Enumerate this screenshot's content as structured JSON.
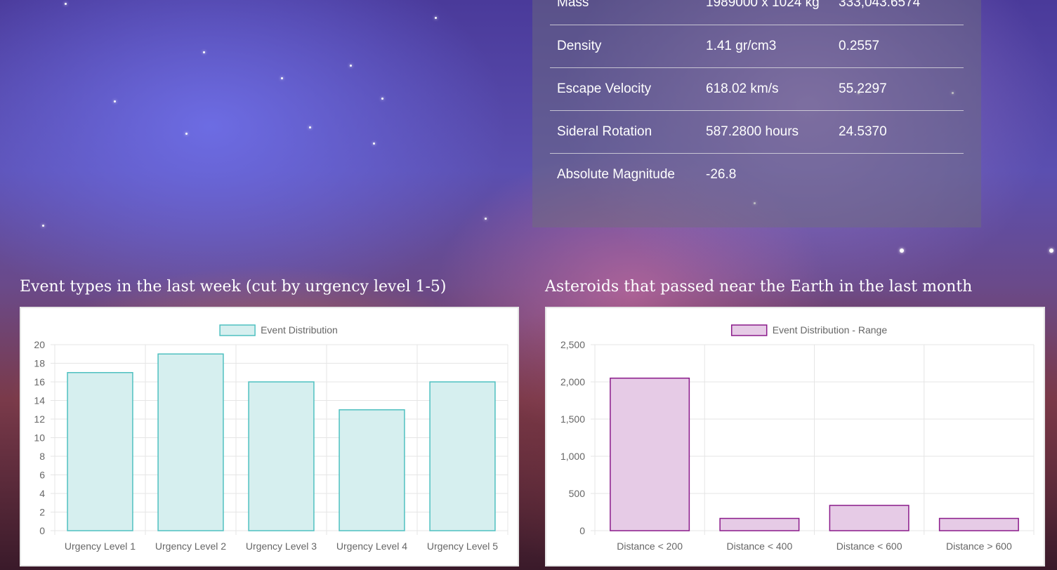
{
  "info_table": {
    "rows": [
      {
        "property": "Mass",
        "value": "1989000 x 1024 kg",
        "relative": "333,043.6574"
      },
      {
        "property": "Density",
        "value": "1.41 gr/cm3",
        "relative": "0.2557"
      },
      {
        "property": "Escape Velocity",
        "value": "618.02 km/s",
        "relative": "55.2297"
      },
      {
        "property": "Sideral Rotation",
        "value": "587.2800 hours",
        "relative": "24.5370"
      },
      {
        "property": "Absolute Magnitude",
        "value": "-26.8",
        "relative": ""
      }
    ]
  },
  "charts": {
    "events_title": "Event types in the last week (cut by urgency level 1-5)",
    "asteroids_title": "Asteroids that passed near the Earth in the last month"
  },
  "chart_data": [
    {
      "type": "bar",
      "title": "Event types in the last week (cut by urgency level 1-5)",
      "categories": [
        "Urgency Level 1",
        "Urgency Level 2",
        "Urgency Level 3",
        "Urgency Level 4",
        "Urgency Level 5"
      ],
      "series": [
        {
          "name": "Event Distribution",
          "values": [
            17,
            19,
            16,
            13,
            16
          ]
        }
      ],
      "ylim": [
        0,
        20
      ],
      "yticks": [
        0,
        2,
        4,
        6,
        8,
        10,
        12,
        14,
        16,
        18,
        20
      ],
      "ytick_labels": [
        "0",
        "2",
        "4",
        "6",
        "8",
        "10",
        "12",
        "14",
        "16",
        "18",
        "20"
      ],
      "grid": true,
      "legend": "top-center",
      "fill": "#d6efef",
      "stroke": "#4fc0c0"
    },
    {
      "type": "bar",
      "title": "Asteroids that passed near the Earth in the last month",
      "categories": [
        "Distance < 200",
        "Distance < 400",
        "Distance < 600",
        "Distance > 600"
      ],
      "series": [
        {
          "name": "Event Distribution - Range",
          "values": [
            2050,
            165,
            340,
            165
          ]
        }
      ],
      "ylim": [
        0,
        2500
      ],
      "yticks": [
        0,
        500,
        1000,
        1500,
        2000,
        2500
      ],
      "ytick_labels": [
        "0",
        "500",
        "1,000",
        "1,500",
        "2,000",
        "2,500"
      ],
      "grid": true,
      "legend": "top-center",
      "fill": "#e6cbe6",
      "stroke": "#8a1a8a"
    }
  ]
}
